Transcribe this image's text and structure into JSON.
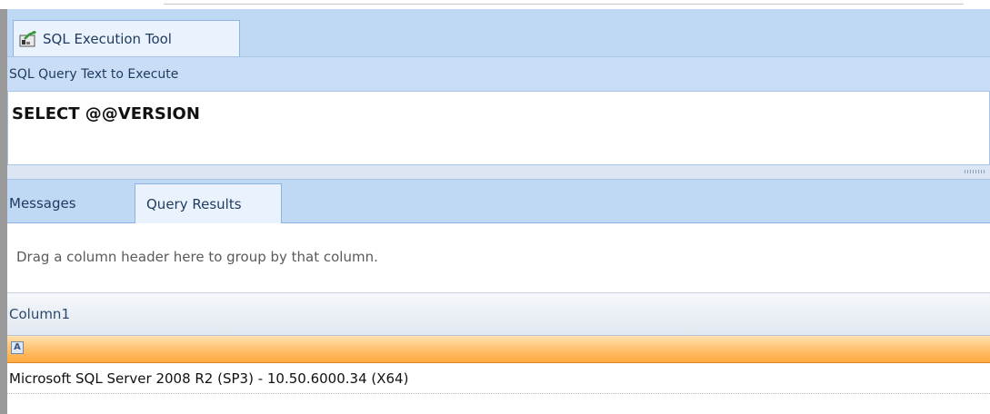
{
  "window": {
    "tab_title": "SQL Execution Tool",
    "tab_icon": "sql-tool-icon"
  },
  "query_section": {
    "header": "SQL Query Text to Execute",
    "query_text": "SELECT @@VERSION"
  },
  "result_tabs": [
    {
      "label": "Messages",
      "active": false
    },
    {
      "label": "Query Results",
      "active": true
    }
  ],
  "grid": {
    "group_panel_text": "Drag a column header here to group by that column.",
    "columns": [
      "Column1"
    ],
    "filter_icon": "filter-a-icon",
    "rows": [
      [
        "Microsoft SQL Server 2008 R2 (SP3) - 10.50.6000.34 (X64)"
      ]
    ]
  },
  "colors": {
    "tab_bar": "#bfd9f5",
    "filter_row": "#ffbf6a",
    "active_tab": "#eaf3fd"
  }
}
